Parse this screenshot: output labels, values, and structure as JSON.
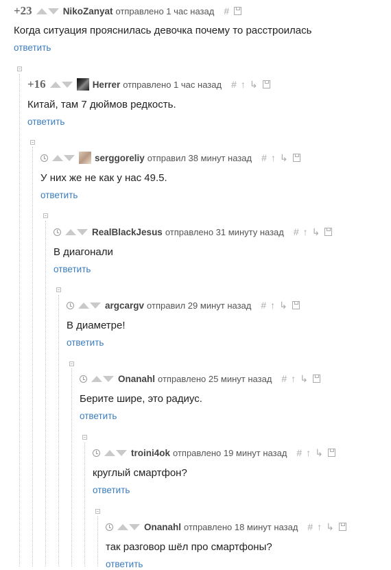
{
  "comments": [
    {
      "rating": "+23",
      "user": "NikoZanyat",
      "meta": "отправлено 1 час назад",
      "text": "Когда ситуация прояснилась девочка почему то расстроилась",
      "reply": "ответить"
    },
    {
      "rating": "+16",
      "user": "Herrer",
      "meta": "отправлено 1 час назад",
      "text": "Китай, там 7 дюймов редкость.",
      "reply": "ответить"
    },
    {
      "user": "serggoreliy",
      "meta": "отправил 38 минут назад",
      "text": "У них же не как у нас 49.5.",
      "reply": "ответить"
    },
    {
      "user": "RealBlackJesus",
      "meta": "отправлено 31 минуту назад",
      "text": "В диагонали",
      "reply": "ответить"
    },
    {
      "user": "argcargv",
      "meta": "отправил 29 минут назад",
      "text": "В диаметре!",
      "reply": "ответить"
    },
    {
      "user": "Onanahl",
      "meta": "отправлено 25 минут назад",
      "text": "Берите шире, это радиус.",
      "reply": "ответить"
    },
    {
      "user": "troini4ok",
      "meta": "отправлено 19 минут назад",
      "text": "круглый смартфон?",
      "reply": "ответить"
    },
    {
      "user": "Onanahl",
      "meta": "отправлено 18 минут назад",
      "text": "так разговор шёл про смартфоны?",
      "reply": "ответить"
    }
  ],
  "colors": {
    "reply_link": "#3a7cbd",
    "arrow": "#c9c9c9",
    "icon": "#aaaaaa"
  },
  "icons": [
    "hash-icon",
    "up-arrow-icon",
    "branch-icon",
    "save-icon",
    "clock-icon",
    "collapse-icon"
  ]
}
